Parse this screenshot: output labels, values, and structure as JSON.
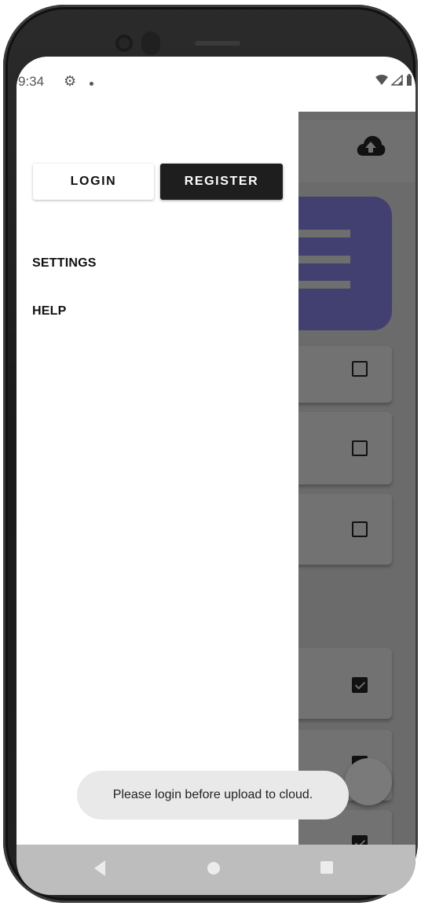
{
  "status_bar": {
    "time": "9:34",
    "gear_icon": "gear-icon",
    "wifi_icon": "wifi-icon",
    "signal_icon": "signal-icon",
    "battery_icon": "battery-icon"
  },
  "drawer": {
    "login_label": "LOGIN",
    "register_label": "REGISTER",
    "menu_items": [
      "SETTINGS",
      "HELP"
    ]
  },
  "app": {
    "upload_icon": "cloud-upload-icon",
    "task_checked": [
      false,
      false,
      false,
      true,
      true,
      true
    ]
  },
  "toast": {
    "message": "Please login before upload to cloud."
  },
  "navigation": {
    "back_icon": "back-triangle-icon",
    "home_icon": "home-circle-icon",
    "recent_icon": "recent-square-icon"
  },
  "colors": {
    "hero_card": "#414070",
    "register_button": "#1e1e1e",
    "scrim": "#6b6b6b"
  }
}
